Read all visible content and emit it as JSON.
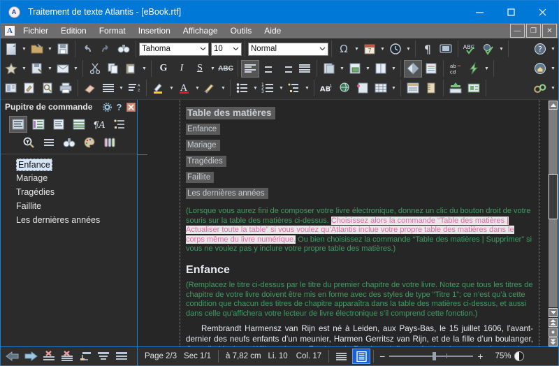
{
  "window": {
    "title": "Traitement de texte Atlantis - [eBook.rtf]",
    "app_icon": "A",
    "minimize": "minimize-icon",
    "maximize": "maximize-icon",
    "close": "close-icon"
  },
  "menubar": {
    "app_icon": "A",
    "items": [
      {
        "label": "Fichier"
      },
      {
        "label": "Edition"
      },
      {
        "label": "Format"
      },
      {
        "label": "Insertion"
      },
      {
        "label": "Affichage"
      },
      {
        "label": "Outils"
      },
      {
        "label": "Aide"
      }
    ],
    "mdi": {
      "minimize": "—",
      "restore": "❐",
      "close": "✕"
    }
  },
  "toolbar": {
    "font_name": "Tahoma",
    "font_size": "10",
    "style_name": "Normal",
    "bold_label": "G",
    "italic_label": "I",
    "underline_label": "S",
    "strike_label": "ABC",
    "super_label": "AB",
    "super_sup": "1",
    "spell_label": "ABC",
    "abcd_top": "ab",
    "abcd_bottom": "cd",
    "help_label": "?"
  },
  "sidebar": {
    "title": "Pupitre de commande",
    "header_icons": [
      "gear-icon",
      "help-icon",
      "close-icon"
    ],
    "tools_row1": [
      "outline-view-icon",
      "multicolumn-icon",
      "document-icon",
      "table-icon",
      "style-icon",
      "list-icon"
    ],
    "tools_row2": [
      "zoom-find-icon",
      "lines-icon",
      "binoculars-icon",
      "palette-icon",
      "clips-icon"
    ],
    "items": [
      {
        "label": "Enfance",
        "selected": true
      },
      {
        "label": "Mariage",
        "selected": false
      },
      {
        "label": "Tragédies",
        "selected": false
      },
      {
        "label": "Faillite",
        "selected": false
      },
      {
        "label": "Les dernières années",
        "selected": false
      }
    ],
    "bottom_icons": [
      "arrow-left-icon",
      "arrow-right-icon",
      "delete-line-icon",
      "delete-all-icon",
      "promote-icon",
      "align-icon",
      "list2-icon"
    ]
  },
  "document": {
    "toc_title": "Table des matières",
    "toc_entries": [
      "Enfance",
      "Mariage",
      "Tragédies",
      "Faillite",
      "Les dernières années"
    ],
    "note1_part1": "(Lorsque vous aurez fini de composer votre livre électronique, donnez un clic du bouton droit de votre souris sur la table des matières ci-dessus. ",
    "note1_selected": "Choisissez alors la commande “Table des matières | Actualiser toute la table” si vous voulez qu’Atlantis inclue votre propre table des matières dans le corps même du livre numérique.",
    "note1_part2": " Ou bien choisissez la commande “Table des matières | Supprimer” si vous ne voulez pas y inclure votre propre table des matières.)",
    "chapter_title": "Enfance",
    "note2": "(Remplacez le titre ci-dessus par le titre du premier chapitre de votre livre. Notez que tous les titres de chapitre de votre livre doivent être mis en forme avec des styles de type “Titre 1”; ce n’est qu’à cette condition que chacun des titres de chapitre apparaîtra dans la table des matières ci-dessus, et aussi dans celle qu’affichera votre lecteur de livre électronique s’il comprend cette fonction.)",
    "paragraph": "Rembrandt Harmensz van Rijn est né à Leiden, aux Pays-Bas, le 15 juillet 1606, l’avant-dernier des neufs enfants d’un meunier, Harmen Gerritsz van Rijn, et de la fille d’un boulanger, Cornelia Neeltgen Willemsdr. van Zuytbroeck. Rembrandt fit ses études dans un lycée classique pendant sept ans, puis entra à l’université de Leiden en 1620, à treize ans. Quelques mois plus"
  },
  "statusbar": {
    "page": "Page 2/3",
    "section": "Sec 1/1",
    "position": "à 7,82 cm",
    "line": "Li. 10",
    "column": "Col. 17",
    "view_normal": "normal-view-icon",
    "view_page": "page-view-icon",
    "zoom_minus": "−",
    "zoom_plus": "+",
    "zoom_value": "75%",
    "contrast": "contrast-icon"
  },
  "colors": {
    "titlebar": "#0078d7",
    "accent_border": "#1d7fd4",
    "toolbar_bg": "#2e2e2e",
    "doc_bg": "#262626",
    "green_text": "#3f9e63",
    "selection_text": "#e06aa8",
    "selection_bg": "#e8e8e8",
    "field_shade": "#5a5a5a",
    "sidebar_selection": "#d6e6f7"
  }
}
